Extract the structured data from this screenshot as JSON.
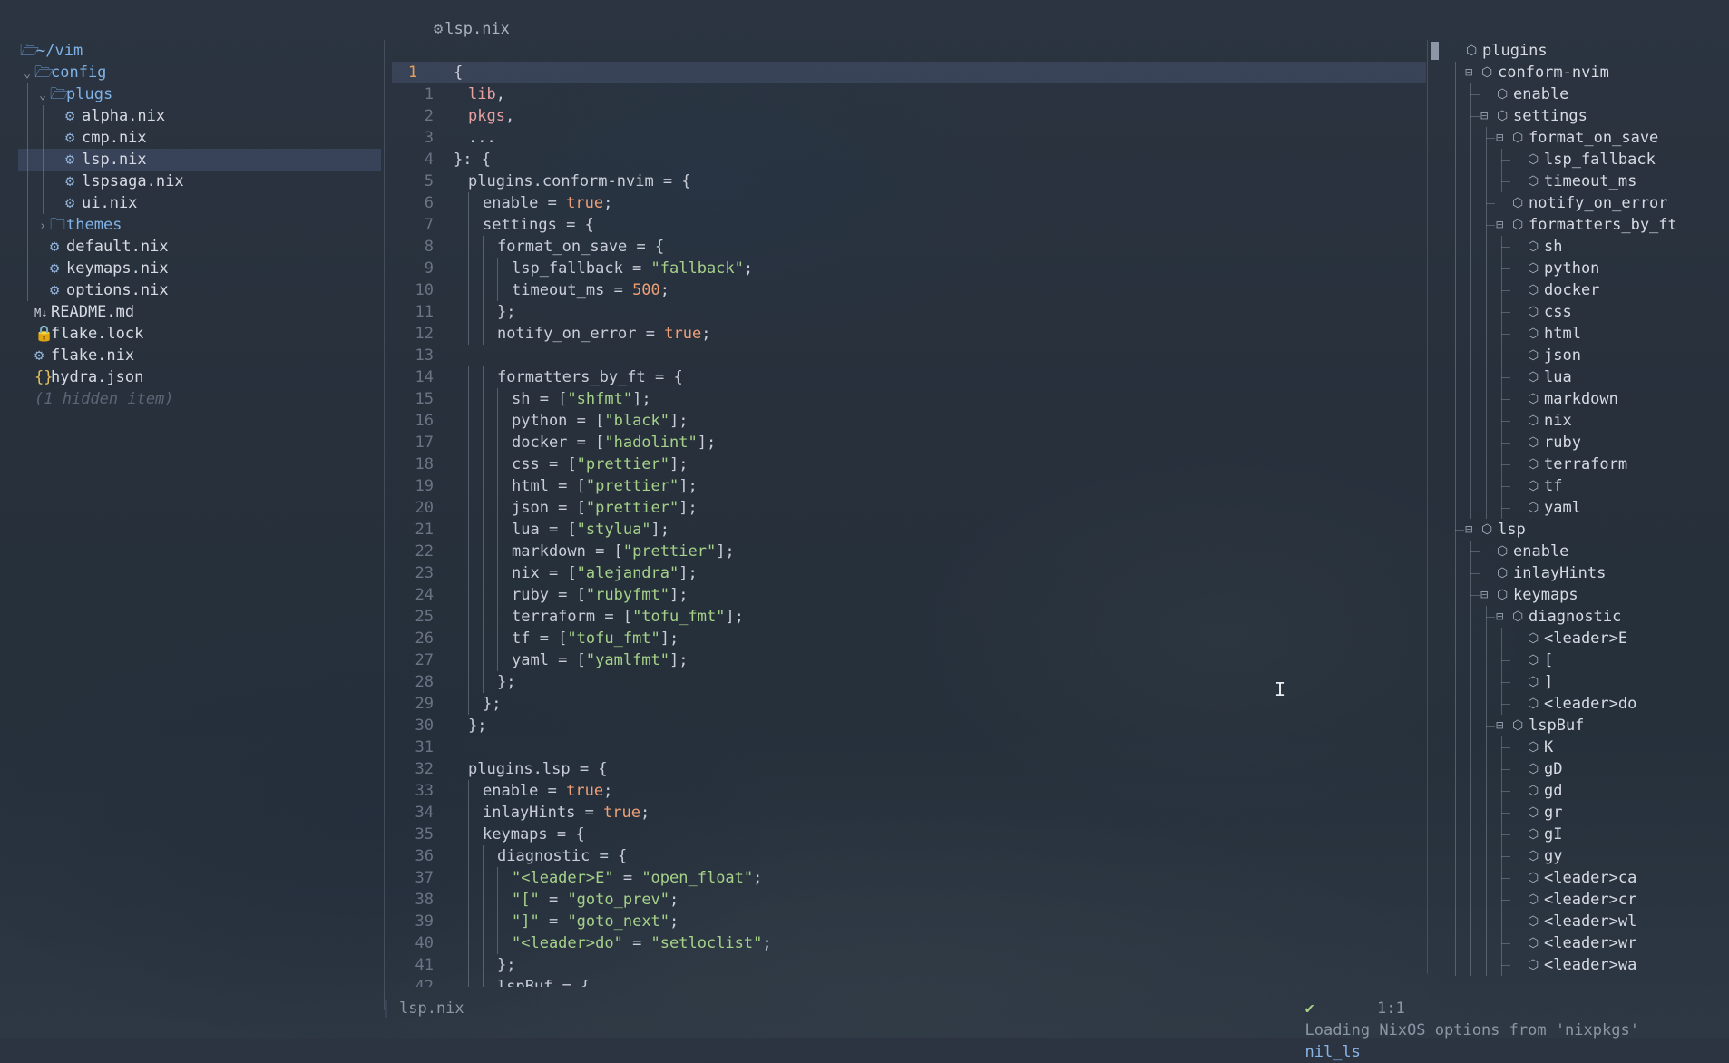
{
  "tabbar": {
    "active_tab": "lsp.nix",
    "tab_icon": "gear-icon"
  },
  "explorer": {
    "rows": [
      {
        "label": "~/vim",
        "kind": "dir-root"
      },
      {
        "label": "config",
        "kind": "dir-open"
      },
      {
        "label": "plugs",
        "kind": "dir-open"
      },
      {
        "label": "alpha.nix",
        "kind": "nix"
      },
      {
        "label": "cmp.nix",
        "kind": "nix"
      },
      {
        "label": "lsp.nix",
        "kind": "nix",
        "selected": true
      },
      {
        "label": "lspsaga.nix",
        "kind": "nix"
      },
      {
        "label": "ui.nix",
        "kind": "nix"
      },
      {
        "label": "themes",
        "kind": "dir-closed"
      },
      {
        "label": "default.nix",
        "kind": "nix"
      },
      {
        "label": "keymaps.nix",
        "kind": "nix"
      },
      {
        "label": "options.nix",
        "kind": "nix"
      },
      {
        "label": "README.md",
        "kind": "md"
      },
      {
        "label": "flake.lock",
        "kind": "lock"
      },
      {
        "label": "flake.nix",
        "kind": "nix"
      },
      {
        "label": "hydra.json",
        "kind": "json"
      },
      {
        "label": "(1 hidden item)",
        "kind": "hidden"
      }
    ]
  },
  "editor": {
    "current_line": "1",
    "lines": [
      {
        "n": "1",
        "text": "{"
      },
      {
        "n": "1",
        "text": "lib,"
      },
      {
        "n": "2",
        "text": "pkgs,"
      },
      {
        "n": "3",
        "text": "..."
      },
      {
        "n": "4",
        "text": "}: {"
      },
      {
        "n": "5",
        "text": "plugins.conform-nvim = {"
      },
      {
        "n": "6",
        "text": "enable = true;"
      },
      {
        "n": "7",
        "text": "settings = {"
      },
      {
        "n": "8",
        "text": "format_on_save = {"
      },
      {
        "n": "9",
        "text": "lsp_fallback = \"fallback\";"
      },
      {
        "n": "10",
        "text": "timeout_ms = 500;"
      },
      {
        "n": "11",
        "text": "};"
      },
      {
        "n": "12",
        "text": "notify_on_error = true;"
      },
      {
        "n": "13",
        "text": ""
      },
      {
        "n": "14",
        "text": "formatters_by_ft = {"
      },
      {
        "n": "15",
        "text": "sh = [\"shfmt\"];"
      },
      {
        "n": "16",
        "text": "python = [\"black\"];"
      },
      {
        "n": "17",
        "text": "docker = [\"hadolint\"];"
      },
      {
        "n": "18",
        "text": "css = [\"prettier\"];"
      },
      {
        "n": "19",
        "text": "html = [\"prettier\"];"
      },
      {
        "n": "20",
        "text": "json = [\"prettier\"];"
      },
      {
        "n": "21",
        "text": "lua = [\"stylua\"];"
      },
      {
        "n": "22",
        "text": "markdown = [\"prettier\"];"
      },
      {
        "n": "23",
        "text": "nix = [\"alejandra\"];"
      },
      {
        "n": "24",
        "text": "ruby = [\"rubyfmt\"];"
      },
      {
        "n": "25",
        "text": "terraform = [\"tofu_fmt\"];"
      },
      {
        "n": "26",
        "text": "tf = [\"tofu_fmt\"];"
      },
      {
        "n": "27",
        "text": "yaml = [\"yamlfmt\"];"
      },
      {
        "n": "28",
        "text": "};"
      },
      {
        "n": "29",
        "text": "};"
      },
      {
        "n": "30",
        "text": "};"
      },
      {
        "n": "31",
        "text": ""
      },
      {
        "n": "32",
        "text": "plugins.lsp = {"
      },
      {
        "n": "33",
        "text": "enable = true;"
      },
      {
        "n": "34",
        "text": "inlayHints = true;"
      },
      {
        "n": "35",
        "text": "keymaps = {"
      },
      {
        "n": "36",
        "text": "diagnostic = {"
      },
      {
        "n": "37",
        "text": "\"<leader>E\" = \"open_float\";"
      },
      {
        "n": "38",
        "text": "\"[\" = \"goto_prev\";"
      },
      {
        "n": "39",
        "text": "\"]\" = \"goto_next\";"
      },
      {
        "n": "40",
        "text": "\"<leader>do\" = \"setloclist\";"
      },
      {
        "n": "41",
        "text": "};"
      },
      {
        "n": "42",
        "text": "lspBuf = {"
      }
    ]
  },
  "outline": {
    "items": [
      {
        "label": "plugins",
        "collapsible": false
      },
      {
        "label": "conform-nvim",
        "collapsible": true
      },
      {
        "label": "enable",
        "collapsible": false
      },
      {
        "label": "settings",
        "collapsible": true
      },
      {
        "label": "format_on_save",
        "collapsible": true
      },
      {
        "label": "lsp_fallback",
        "collapsible": false
      },
      {
        "label": "timeout_ms",
        "collapsible": false
      },
      {
        "label": "notify_on_error",
        "collapsible": false
      },
      {
        "label": "formatters_by_ft",
        "collapsible": true
      },
      {
        "label": "sh",
        "collapsible": false
      },
      {
        "label": "python",
        "collapsible": false
      },
      {
        "label": "docker",
        "collapsible": false
      },
      {
        "label": "css",
        "collapsible": false
      },
      {
        "label": "html",
        "collapsible": false
      },
      {
        "label": "json",
        "collapsible": false
      },
      {
        "label": "lua",
        "collapsible": false
      },
      {
        "label": "markdown",
        "collapsible": false
      },
      {
        "label": "nix",
        "collapsible": false
      },
      {
        "label": "ruby",
        "collapsible": false
      },
      {
        "label": "terraform",
        "collapsible": false
      },
      {
        "label": "tf",
        "collapsible": false
      },
      {
        "label": "yaml",
        "collapsible": false
      },
      {
        "label": "lsp",
        "collapsible": true
      },
      {
        "label": "enable",
        "collapsible": false
      },
      {
        "label": "inlayHints",
        "collapsible": false
      },
      {
        "label": "keymaps",
        "collapsible": true
      },
      {
        "label": "diagnostic",
        "collapsible": true
      },
      {
        "label": "<leader>E",
        "collapsible": false
      },
      {
        "label": "[",
        "collapsible": false
      },
      {
        "label": "]",
        "collapsible": false
      },
      {
        "label": "<leader>do",
        "collapsible": false
      },
      {
        "label": "lspBuf",
        "collapsible": true
      },
      {
        "label": "K",
        "collapsible": false
      },
      {
        "label": "gD",
        "collapsible": false
      },
      {
        "label": "gd",
        "collapsible": false
      },
      {
        "label": "gr",
        "collapsible": false
      },
      {
        "label": "gI",
        "collapsible": false
      },
      {
        "label": "gy",
        "collapsible": false
      },
      {
        "label": "<leader>ca",
        "collapsible": false
      },
      {
        "label": "<leader>cr",
        "collapsible": false
      },
      {
        "label": "<leader>wl",
        "collapsible": false
      },
      {
        "label": "<leader>wr",
        "collapsible": false
      },
      {
        "label": "<leader>wa",
        "collapsible": false
      }
    ]
  },
  "notification": {
    "check": "✔",
    "message": "Loading NixOS options from 'nixpkgs'",
    "source": "nil_ls"
  },
  "statusline": {
    "filename": "lsp.nix",
    "position": "1:1"
  },
  "colors": {
    "string": "#a6d189",
    "number": "#ef9f76",
    "identifier": "#e7a1a1",
    "directory": "#7fb2e6",
    "current_line_number": "#e6a05a"
  }
}
